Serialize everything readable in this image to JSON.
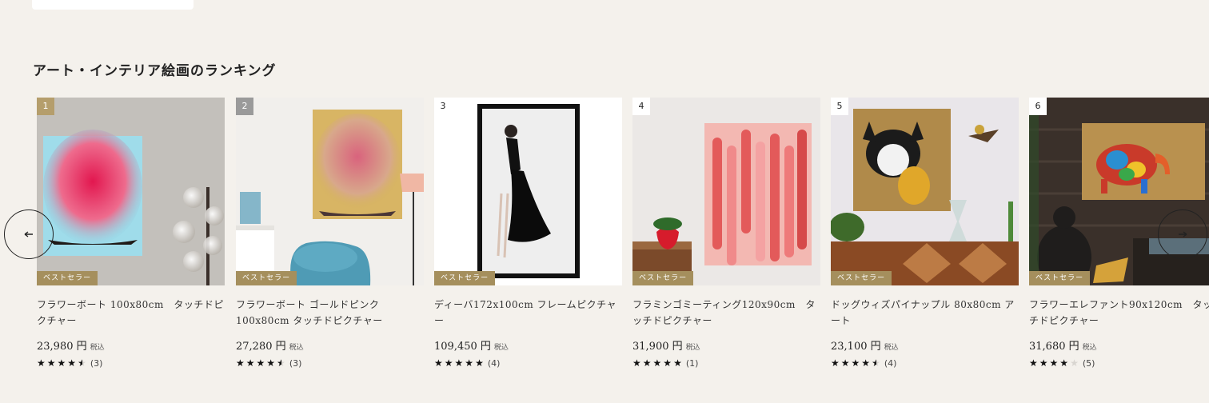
{
  "section": {
    "title": "アート・インテリア絵画のランキング"
  },
  "badge_label": "ベストセラー",
  "tax_label": "税込",
  "products": [
    {
      "rank": "1",
      "name": "フラワーボート 100x80cm　タッチドピクチャー",
      "price": "23,980 円",
      "rating": 4.5,
      "count": "(3)"
    },
    {
      "rank": "2",
      "name": "フラワーボート ゴールドピンク 100x80cm タッチドピクチャー",
      "price": "27,280 円",
      "rating": 4.5,
      "count": "(3)"
    },
    {
      "rank": "3",
      "name": "ディーバ172x100cm フレームピクチャー",
      "price": "109,450 円",
      "rating": 5,
      "count": "(4)"
    },
    {
      "rank": "4",
      "name": "フラミンゴミーティング120x90cm　タッチドピクチャー",
      "price": "31,900 円",
      "rating": 5,
      "count": "(1)"
    },
    {
      "rank": "5",
      "name": "ドッグウィズパイナップル 80x80cm アート",
      "price": "23,100 円",
      "rating": 4.5,
      "count": "(4)"
    },
    {
      "rank": "6",
      "name": "フラワーエレファント90x120cm　タッチドピクチャー",
      "price": "31,680 円",
      "rating": 4,
      "count": "(5)"
    }
  ]
}
